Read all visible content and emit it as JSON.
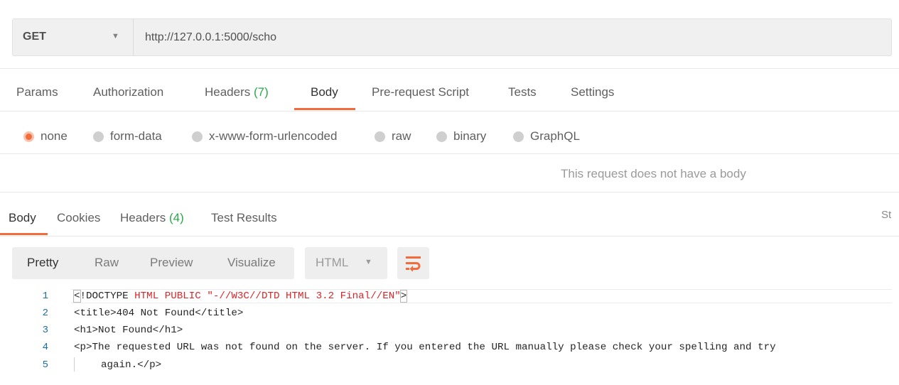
{
  "request": {
    "method": "GET",
    "url": "http://127.0.0.1:5000/scho"
  },
  "request_tabs": [
    {
      "label": "Params"
    },
    {
      "label": "Authorization"
    },
    {
      "label": "Headers",
      "count": "(7)"
    },
    {
      "label": "Body",
      "active": true
    },
    {
      "label": "Pre-request Script"
    },
    {
      "label": "Tests"
    },
    {
      "label": "Settings"
    }
  ],
  "body_types": [
    {
      "label": "none",
      "selected": true
    },
    {
      "label": "form-data"
    },
    {
      "label": "x-www-form-urlencoded"
    },
    {
      "label": "raw"
    },
    {
      "label": "binary"
    },
    {
      "label": "GraphQL"
    }
  ],
  "no_body_message": "This request does not have a body",
  "response_tabs": [
    {
      "label": "Body",
      "active": true
    },
    {
      "label": "Cookies"
    },
    {
      "label": "Headers",
      "count": "(4)"
    },
    {
      "label": "Test Results"
    }
  ],
  "status_cut": "St",
  "view_modes": [
    {
      "label": "Pretty",
      "active": true
    },
    {
      "label": "Raw"
    },
    {
      "label": "Preview"
    },
    {
      "label": "Visualize"
    }
  ],
  "language": "HTML",
  "code": {
    "line_numbers": [
      "1",
      "2",
      "3",
      "4",
      "5"
    ],
    "l1_open": "<",
    "l1_doctype": "!DOCTYPE",
    "l1_rest": " HTML PUBLIC \"-//W3C//DTD HTML 3.2 Final//EN\"",
    "l1_close": ">",
    "l2": "<title>404 Not Found</title>",
    "l3": "<h1>Not Found</h1>",
    "l4": "<p>The requested URL was not found on the server. If you entered the URL manually please check your spelling and try",
    "l5": "again.</p>"
  },
  "colors": {
    "accent": "#f26b3a",
    "count_green": "#2aa84a",
    "code_red": "#d9262a",
    "line_number_blue": "#1c6fa0"
  },
  "icons": {
    "method_dropdown": "chevron-down-icon",
    "language_dropdown": "chevron-down-icon",
    "wrap": "wrap-lines-icon"
  }
}
